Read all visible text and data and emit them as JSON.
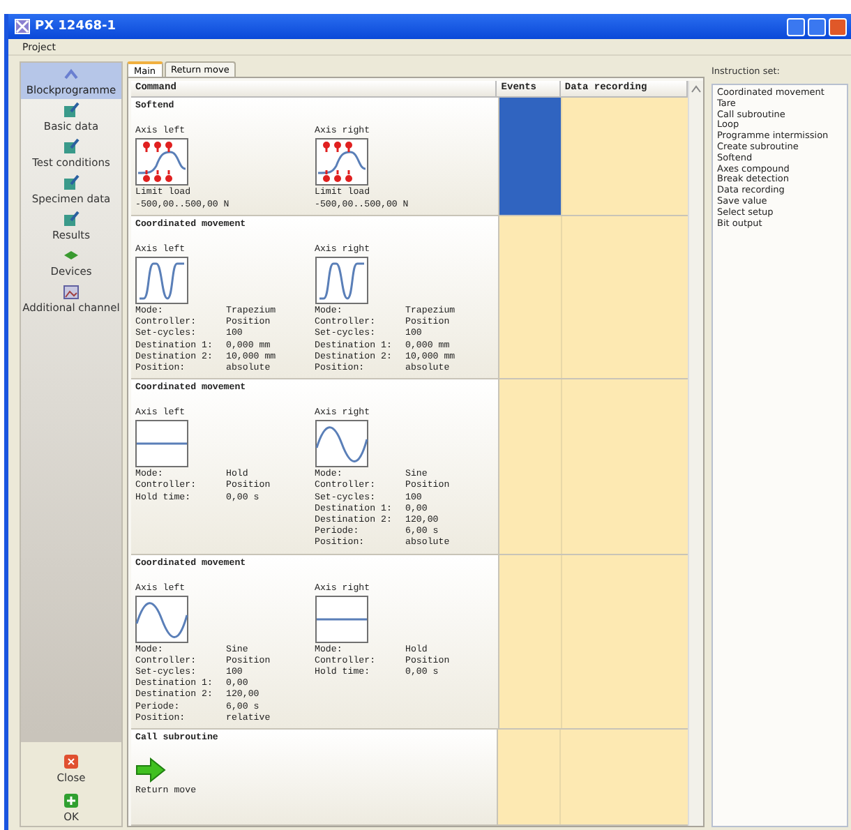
{
  "window": {
    "title": "PX 12468-1"
  },
  "menu": [
    "Project"
  ],
  "sidebar": {
    "items": [
      {
        "label": "Blockprogramme",
        "kind": "chevron",
        "selected": true
      },
      {
        "label": "Basic data",
        "kind": "edit",
        "selected": false
      },
      {
        "label": "Test conditions",
        "kind": "edit",
        "selected": false
      },
      {
        "label": "Specimen data",
        "kind": "edit",
        "selected": false
      },
      {
        "label": "Results",
        "kind": "edit",
        "selected": false
      },
      {
        "label": "Devices",
        "kind": "device",
        "selected": false
      },
      {
        "label": "Additional channel",
        "kind": "channel",
        "selected": false
      }
    ],
    "buttons": [
      {
        "label": "Close",
        "kind": "close"
      },
      {
        "label": "OK",
        "kind": "ok"
      }
    ]
  },
  "tabs": [
    {
      "label": "Main",
      "selected": true
    },
    {
      "label": "Return move",
      "selected": false
    }
  ],
  "table": {
    "columns": [
      "Command",
      "Events",
      "Data recording"
    ],
    "rows": [
      {
        "title": "Softend",
        "events_selected": true,
        "axes": [
          {
            "label": "Axis left",
            "kind": "softend",
            "caption": [
              "Limit load",
              "-500,00..500,00 N"
            ]
          },
          {
            "label": "Axis right",
            "kind": "softend",
            "caption": [
              "Limit load",
              "-500,00..500,00 N"
            ]
          }
        ]
      },
      {
        "title": "Coordinated movement",
        "events_selected": false,
        "axes": [
          {
            "label": "Axis left",
            "kind": "trapezium",
            "params": [
              [
                "Mode:",
                "Trapezium"
              ],
              [
                "Controller:",
                "Position"
              ],
              [
                "Set-cycles:",
                "100"
              ],
              [
                "Destination 1:",
                "0,000 mm"
              ],
              [
                "Destination 2:",
                "10,000 mm"
              ],
              [
                "Position:",
                "absolute"
              ]
            ]
          },
          {
            "label": "Axis right",
            "kind": "trapezium",
            "params": [
              [
                "Mode:",
                "Trapezium"
              ],
              [
                "Controller:",
                "Position"
              ],
              [
                "Set-cycles:",
                "100"
              ],
              [
                "Destination 1:",
                "0,000 mm"
              ],
              [
                "Destination 2:",
                "10,000 mm"
              ],
              [
                "Position:",
                "absolute"
              ]
            ]
          }
        ]
      },
      {
        "title": "Coordinated movement",
        "events_selected": false,
        "axes": [
          {
            "label": "Axis left",
            "kind": "hold",
            "params": [
              [
                "Mode:",
                "Hold"
              ],
              [
                "Controller:",
                "Position"
              ],
              [
                "Hold time:",
                "0,00 s"
              ]
            ]
          },
          {
            "label": "Axis right",
            "kind": "sine",
            "params": [
              [
                "Mode:",
                "Sine"
              ],
              [
                "Controller:",
                "Position"
              ],
              [
                "Set-cycles:",
                "100"
              ],
              [
                "Destination 1:",
                "0,00"
              ],
              [
                "Destination 2:",
                "120,00"
              ],
              [
                "Periode:",
                "6,00 s"
              ],
              [
                "Position:",
                "absolute"
              ]
            ]
          }
        ]
      },
      {
        "title": "Coordinated movement",
        "events_selected": false,
        "axes": [
          {
            "label": "Axis left",
            "kind": "sine",
            "params": [
              [
                "Mode:",
                "Sine"
              ],
              [
                "Controller:",
                "Position"
              ],
              [
                "Set-cycles:",
                "100"
              ],
              [
                "Destination 1:",
                "0,00"
              ],
              [
                "Destination 2:",
                "120,00"
              ],
              [
                "Periode:",
                "6,00 s"
              ],
              [
                "Position:",
                "relative"
              ]
            ]
          },
          {
            "label": "Axis right",
            "kind": "hold",
            "params": [
              [
                "Mode:",
                "Hold"
              ],
              [
                "Controller:",
                "Position"
              ],
              [
                "Hold time:",
                "0,00 s"
              ]
            ]
          }
        ]
      },
      {
        "title": "Call subroutine",
        "events_selected": false,
        "subroutine": "Return move"
      }
    ]
  },
  "instruction_set": {
    "title": "Instruction set:",
    "items": [
      "Coordinated movement",
      "Tare",
      "Call subroutine",
      "Loop",
      "Programme intermission",
      "Create subroutine",
      "Softend",
      "Axes compound",
      "Break detection",
      "Data recording",
      "Save value",
      "Select setup",
      "Bit output"
    ]
  }
}
